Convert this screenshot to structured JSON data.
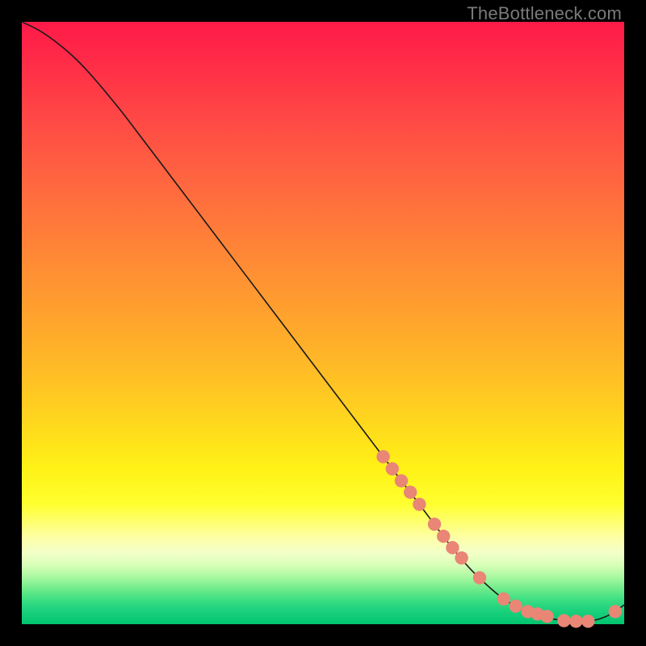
{
  "watermark": "TheBottleneck.com",
  "colors": {
    "curve": "#1a1a1a",
    "marker_fill": "#e98676",
    "marker_stroke": "#cc6f60"
  },
  "chart_data": {
    "type": "line",
    "title": "",
    "xlabel": "",
    "ylabel": "",
    "xlim": [
      0,
      100
    ],
    "ylim": [
      0,
      100
    ],
    "grid": false,
    "series": [
      {
        "name": "bottleneck-curve",
        "x": [
          0,
          3,
          6,
          9,
          12,
          16,
          20,
          25,
          30,
          35,
          40,
          45,
          50,
          55,
          60,
          63,
          66,
          69,
          72,
          75,
          78,
          80,
          82,
          84,
          86,
          88,
          90,
          92,
          94,
          96,
          98,
          100
        ],
        "y": [
          100,
          98.5,
          96.4,
          93.8,
          90.6,
          85.8,
          80.6,
          74.0,
          67.4,
          60.8,
          54.2,
          47.6,
          41.0,
          34.4,
          27.8,
          23.8,
          19.9,
          15.9,
          12.0,
          8.6,
          5.8,
          4.2,
          3.0,
          2.1,
          1.4,
          0.9,
          0.6,
          0.5,
          0.5,
          0.9,
          1.8,
          3.2
        ]
      }
    ],
    "markers": {
      "name": "highlight-segment",
      "x": [
        60,
        61.5,
        63,
        64.5,
        66,
        68.5,
        70,
        71.5,
        73,
        76,
        80,
        82,
        84,
        85.6,
        87.2,
        90,
        92,
        94,
        98.5
      ],
      "y": [
        27.8,
        25.8,
        23.8,
        21.9,
        19.9,
        16.6,
        14.6,
        12.7,
        11.0,
        7.7,
        4.2,
        3.0,
        2.1,
        1.7,
        1.3,
        0.6,
        0.5,
        0.5,
        2.1
      ]
    }
  }
}
